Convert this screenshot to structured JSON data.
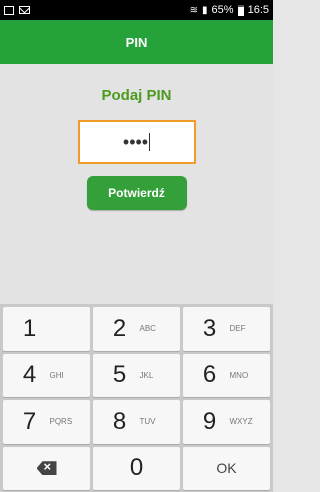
{
  "status_bar": {
    "signal_text": " .   . ",
    "battery": "65%",
    "time": "16:5"
  },
  "header": {
    "title": "PIN"
  },
  "main": {
    "prompt": "Podaj PIN",
    "pin_value": "••••",
    "confirm_label": "Potwierdź"
  },
  "keypad": {
    "keys": [
      {
        "digit": "1",
        "letters": ""
      },
      {
        "digit": "2",
        "letters": "ABC"
      },
      {
        "digit": "3",
        "letters": "DEF"
      },
      {
        "digit": "4",
        "letters": "GHI"
      },
      {
        "digit": "5",
        "letters": "JKL"
      },
      {
        "digit": "6",
        "letters": "MNO"
      },
      {
        "digit": "7",
        "letters": "PQRS"
      },
      {
        "digit": "8",
        "letters": "TUV"
      },
      {
        "digit": "9",
        "letters": "WXYZ"
      },
      {
        "digit": "0",
        "letters": ""
      }
    ],
    "ok_label": "OK"
  },
  "colors": {
    "header_green": "#26a23a",
    "prompt_green": "#4c9a1f",
    "input_border_orange": "#f19b2c",
    "button_green": "#34a03a"
  },
  "icons": [
    "notification-icon",
    "mail-icon",
    "wifi-icon",
    "signal-icon",
    "battery-icon",
    "backspace-icon"
  ]
}
